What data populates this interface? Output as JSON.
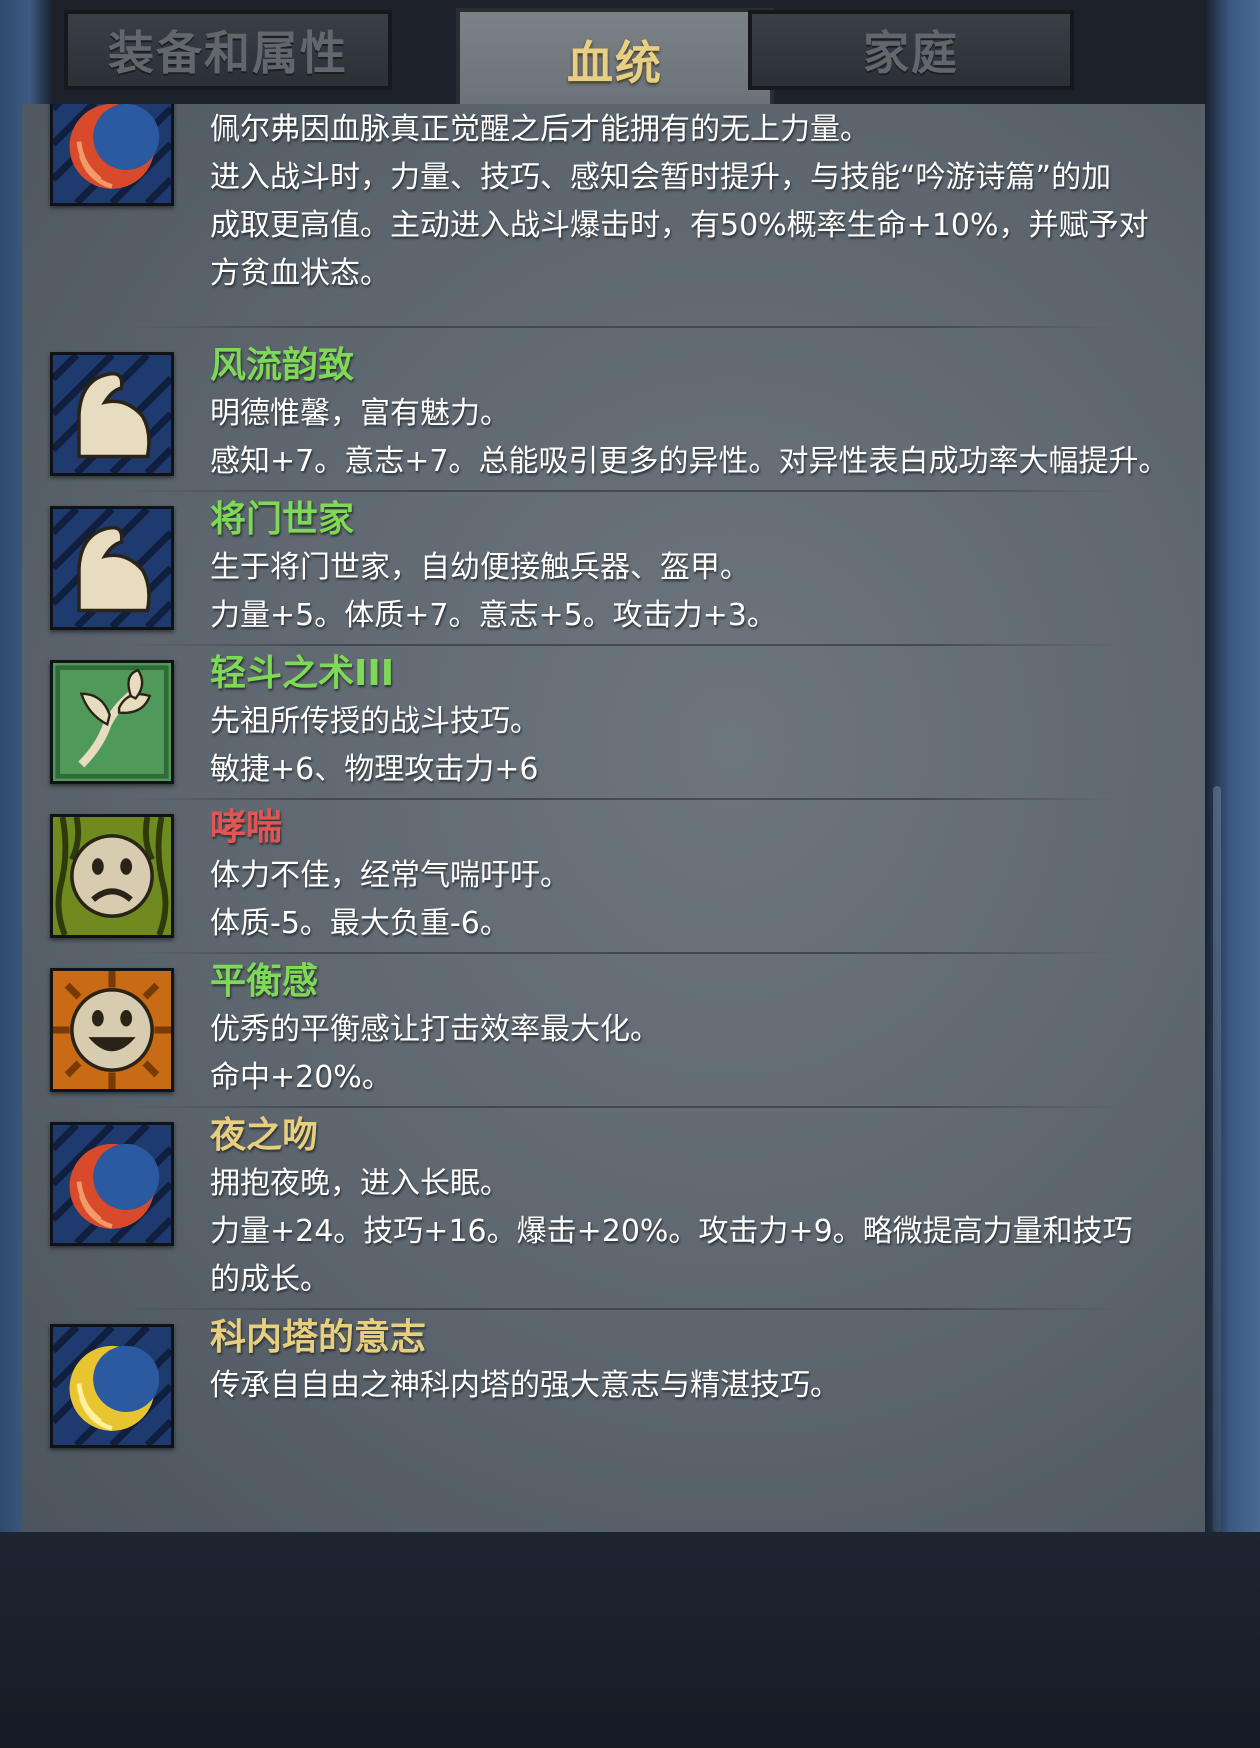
{
  "tabs": [
    {
      "label": "装备和属性",
      "active": false
    },
    {
      "label": "血统",
      "active": true
    },
    {
      "label": "家庭",
      "active": false
    }
  ],
  "colors": {
    "title_green": "#7ed957",
    "title_red": "#e25555",
    "title_gold": "#e8cf7d",
    "text": "#ffffff"
  },
  "entries": [
    {
      "title": "",
      "icon": "crimson-crescent-icon",
      "lines": [
        "佩尔弗因血脉真正觉醒之后才能拥有的无上力量。",
        "进入战斗时，力量、技巧、感知会暂时提升，与技能“吟游诗篇”的加",
        "成取更高值。主动进入战斗爆击时，有50%概率生命+10%，并赋予对",
        "方贫血状态。"
      ]
    },
    {
      "title": "风流韵致",
      "title_color": "green",
      "icon": "flexed-arm-icon",
      "lines": [
        "明德惟馨，富有魅力。",
        "感知+7。意志+7。总能吸引更多的异性。对异性表白成功率大幅提升。"
      ]
    },
    {
      "title": "将门世家",
      "title_color": "green",
      "icon": "flexed-arm-icon",
      "lines": [
        "生于将门世家，自幼便接触兵器、盔甲。",
        "力量+5。体质+7。意志+5。攻击力+3。"
      ]
    },
    {
      "title": "轻斗之术III",
      "title_color": "green",
      "icon": "leaf-sprig-icon",
      "lines": [
        "先祖所传授的战斗技巧。",
        "敏捷+6、物理攻击力+6"
      ]
    },
    {
      "title": "哮喘",
      "title_color": "red",
      "icon": "sad-face-icon",
      "lines": [
        "体力不佳，经常气喘吁吁。",
        "体质-5。最大负重-6。"
      ]
    },
    {
      "title": "平衡感",
      "title_color": "green",
      "icon": "happy-face-icon",
      "lines": [
        "优秀的平衡感让打击效率最大化。",
        "命中+20%。"
      ]
    },
    {
      "title": "夜之吻",
      "title_color": "gold",
      "icon": "crimson-crescent-icon",
      "lines": [
        "拥抱夜晚，进入长眠。",
        "力量+24。技巧+16。爆击+20%。攻击力+9。略微提高力量和技巧",
        "的成长。"
      ]
    },
    {
      "title": "科内塔的意志",
      "title_color": "gold",
      "icon": "golden-crescent-icon",
      "lines": [
        "传承自自由之神科内塔的强大意志与精湛技巧。"
      ]
    }
  ]
}
